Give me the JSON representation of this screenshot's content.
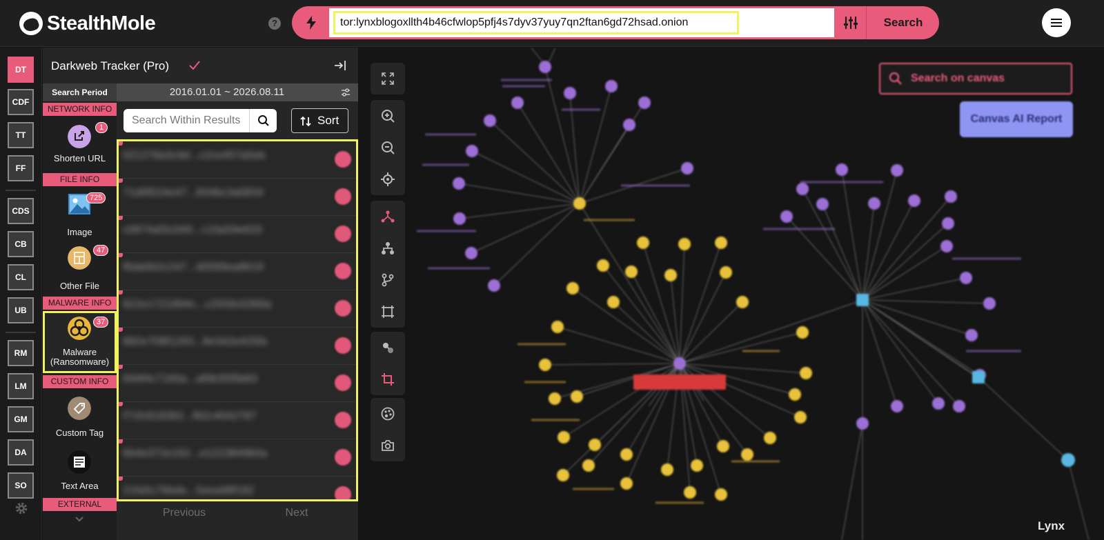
{
  "brand": {
    "name": "StealthMole"
  },
  "search": {
    "query": "tor:lynxblogoxllth4b46cfwlop5pfj4s7dyv37yuy7qn2ftan6gd72hsad.onion",
    "button_label": "Search"
  },
  "rail": {
    "items": [
      "DT",
      "CDF",
      "TT",
      "FF",
      "CDS",
      "CB",
      "CL",
      "UB",
      "RM",
      "LM",
      "GM",
      "DA",
      "SO"
    ],
    "active": "DT"
  },
  "panel": {
    "title": "Darkweb Tracker (Pro)",
    "search_period_label": "Search Period",
    "search_period_value": "2016.01.01 ~ 2026.08.11",
    "categories": {
      "network_header": "NETWORK INFO",
      "shorten_url": {
        "label": "Shorten URL",
        "count": "1"
      },
      "file_header": "FILE INFO",
      "image": {
        "label": "Image",
        "count": "725"
      },
      "other_file": {
        "label": "Other File",
        "count": "47"
      },
      "malware_header": "MALWARE INFO",
      "malware": {
        "label_line1": "Malware",
        "label_line2": "(Ransomware)",
        "count": "37"
      },
      "custom_header": "CUSTOM INFO",
      "custom_tag": {
        "label": "Custom Tag"
      },
      "text_area": {
        "label": "Text Area"
      },
      "external_header": "EXTERNAL"
    },
    "list_search_placeholder": "Search Within Results",
    "sort_label": "Sort",
    "results": [
      "021278a3c9d...c2ce457a5eb",
      "71d6f024e47...834bc3a0834",
      "c0874af3c049...c10a59e633",
      "f6da5b2c247...40569ea8619",
      "822e1721894c...c2559c0369a",
      "882e708f1293...8e342e425fa",
      "694f4c7160a...af0b35f5b83",
      "f71fc818362...f62c4042787",
      "6b4e372e162...e1223849b0a",
      "21fa5c76bde...5eea98f182"
    ],
    "prev_label": "Previous",
    "next_label": "Next"
  },
  "canvas": {
    "search_placeholder": "Search on canvas",
    "ai_report_label": "Canvas AI Report",
    "footer_label": "Lynx"
  },
  "colors": {
    "accent_pink": "#e85b7a",
    "highlight_yellow": "#eef35e",
    "node_purple": "#9c6fd6",
    "node_yellow": "#e8c23a",
    "node_blue": "#59b7e3",
    "ai_button": "#8f95f3"
  }
}
